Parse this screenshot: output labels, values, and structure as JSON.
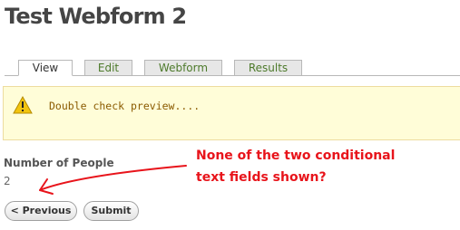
{
  "page": {
    "title": "Test Webform 2"
  },
  "tabs": [
    {
      "label": "View",
      "active": true
    },
    {
      "label": "Edit",
      "active": false
    },
    {
      "label": "Webform",
      "active": false
    },
    {
      "label": "Results",
      "active": false
    }
  ],
  "message": {
    "icon": "warning-triangle-icon",
    "text": "Double check preview...."
  },
  "field": {
    "label": "Number of People",
    "value": "2"
  },
  "buttons": {
    "previous_label": "< Previous",
    "submit_label": "Submit"
  },
  "annotation": {
    "line1": "None of the two conditional",
    "line2": "text fields shown?",
    "color": "#e8141b"
  },
  "colors": {
    "tab_link": "#4d7a2b",
    "warning_bg": "#fffdd8",
    "warning_text": "#8a5a00"
  }
}
